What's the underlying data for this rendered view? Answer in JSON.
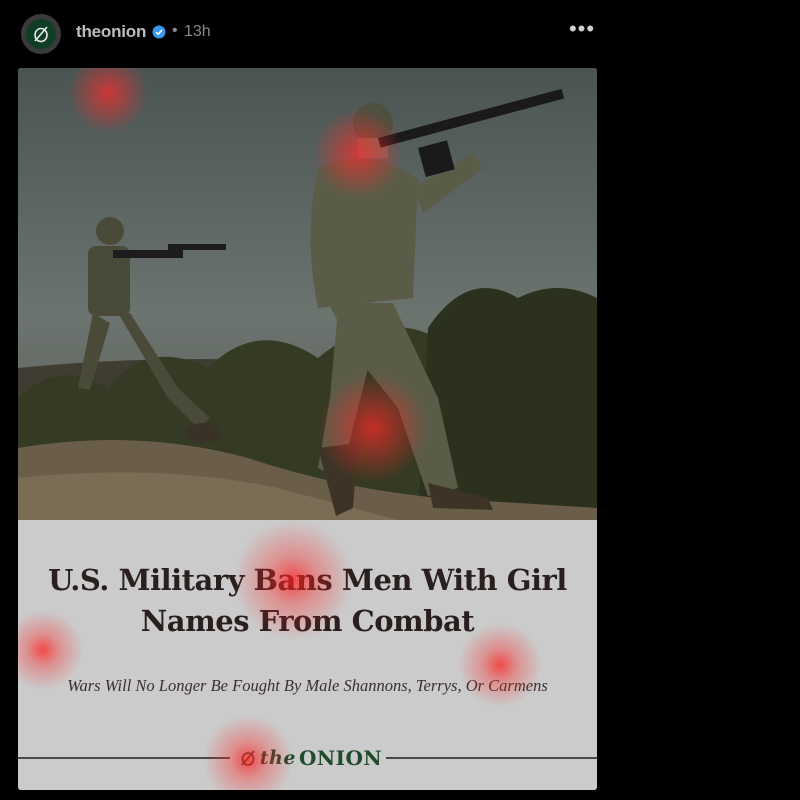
{
  "post": {
    "username": "theonion",
    "separator": "•",
    "timestamp": "13h",
    "more_label": "•••"
  },
  "icons": {
    "avatar": "onion-logo-icon",
    "verified": "verified-badge-icon",
    "more": "more-options-icon",
    "logo": "onion-slash-icon"
  },
  "card": {
    "headline": "U.S. Military Bans Men With Girl Names From Combat",
    "subhead": "Wars Will No Longer Be Fought By Male Shannons, Terrys, Or Carmens",
    "logo_the": "the",
    "logo_onion": "ONION"
  },
  "colors": {
    "background": "#000000",
    "brand_green": "#1f4a2c",
    "verified_blue": "#3897f0"
  }
}
